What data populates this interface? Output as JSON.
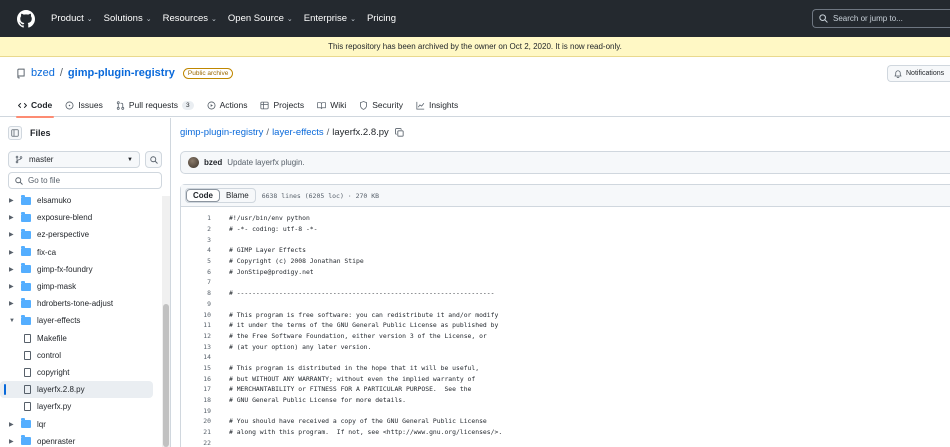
{
  "nav": {
    "items": [
      {
        "label": "Product",
        "dropdown": true
      },
      {
        "label": "Solutions",
        "dropdown": true
      },
      {
        "label": "Resources",
        "dropdown": true
      },
      {
        "label": "Open Source",
        "dropdown": true
      },
      {
        "label": "Enterprise",
        "dropdown": true
      },
      {
        "label": "Pricing",
        "dropdown": false
      }
    ],
    "search_placeholder": "Search or jump to..."
  },
  "banner": {
    "text": "This repository has been archived by the owner on Oct 2, 2020. It is now read-only."
  },
  "repo": {
    "owner": "bzed",
    "separator": "/",
    "name": "gimp-plugin-registry",
    "badge": "Public archive",
    "notifications_label": "Notifications"
  },
  "tabs": [
    {
      "label": "Code",
      "icon": "code-icon",
      "active": true
    },
    {
      "label": "Issues",
      "icon": "issue-icon"
    },
    {
      "label": "Pull requests",
      "icon": "pull-request-icon",
      "count": "3"
    },
    {
      "label": "Actions",
      "icon": "play-icon"
    },
    {
      "label": "Projects",
      "icon": "table-icon"
    },
    {
      "label": "Wiki",
      "icon": "book-icon"
    },
    {
      "label": "Security",
      "icon": "shield-icon"
    },
    {
      "label": "Insights",
      "icon": "graph-icon"
    }
  ],
  "sidebar": {
    "title": "Files",
    "branch": "master",
    "goto_placeholder": "Go to file",
    "tree": [
      {
        "label": "elsamuko",
        "type": "folder",
        "expanded": false
      },
      {
        "label": "exposure-blend",
        "type": "folder",
        "expanded": false
      },
      {
        "label": "ez-perspective",
        "type": "folder",
        "expanded": false
      },
      {
        "label": "fix-ca",
        "type": "folder",
        "expanded": false
      },
      {
        "label": "gimp-fx-foundry",
        "type": "folder",
        "expanded": false
      },
      {
        "label": "gimp-mask",
        "type": "folder",
        "expanded": false
      },
      {
        "label": "hdroberts-tone-adjust",
        "type": "folder",
        "expanded": false
      },
      {
        "label": "layer-effects",
        "type": "folder",
        "expanded": true
      },
      {
        "label": "Makefile",
        "type": "file"
      },
      {
        "label": "control",
        "type": "file"
      },
      {
        "label": "copyright",
        "type": "file"
      },
      {
        "label": "layerfx.2.8.py",
        "type": "file",
        "selected": true
      },
      {
        "label": "layerfx.py",
        "type": "file"
      },
      {
        "label": "lqr",
        "type": "folder",
        "expanded": false
      },
      {
        "label": "openraster",
        "type": "folder",
        "expanded": false
      }
    ]
  },
  "breadcrumb": {
    "repo": "gimp-plugin-registry",
    "folder": "layer-effects",
    "file": "layerfx.2.8.py",
    "sep": "/"
  },
  "commit": {
    "author": "bzed",
    "message": "Update layerfx plugin."
  },
  "code": {
    "code_tab": "Code",
    "blame_tab": "Blame",
    "meta": "6638 lines (6205 loc) · 270 KB",
    "lines": [
      {
        "n": "1",
        "t": "#!/usr/bin/env python"
      },
      {
        "n": "2",
        "t": "# -*- coding: utf-8 -*-"
      },
      {
        "n": "3",
        "t": ""
      },
      {
        "n": "4",
        "t": "# GIMP Layer Effects"
      },
      {
        "n": "5",
        "t": "# Copyright (c) 2008 Jonathan Stipe"
      },
      {
        "n": "6",
        "t": "# JonStipe@prodigy.net"
      },
      {
        "n": "7",
        "t": ""
      },
      {
        "n": "8",
        "t": "# -------------------------------------------------------------------"
      },
      {
        "n": "9",
        "t": ""
      },
      {
        "n": "10",
        "t": "# This program is free software: you can redistribute it and/or modify"
      },
      {
        "n": "11",
        "t": "# it under the terms of the GNU General Public License as published by"
      },
      {
        "n": "12",
        "t": "# the Free Software Foundation, either version 3 of the License, or"
      },
      {
        "n": "13",
        "t": "# (at your option) any later version."
      },
      {
        "n": "14",
        "t": ""
      },
      {
        "n": "15",
        "t": "# This program is distributed in the hope that it will be useful,"
      },
      {
        "n": "16",
        "t": "# but WITHOUT ANY WARRANTY; without even the implied warranty of"
      },
      {
        "n": "17",
        "t": "# MERCHANTABILITY or FITNESS FOR A PARTICULAR PURPOSE.  See the"
      },
      {
        "n": "18",
        "t": "# GNU General Public License for more details."
      },
      {
        "n": "19",
        "t": ""
      },
      {
        "n": "20",
        "t": "# You should have received a copy of the GNU General Public License"
      },
      {
        "n": "21",
        "t": "# along with this program.  If not, see <http://www.gnu.org/licenses/>."
      },
      {
        "n": "22",
        "t": ""
      }
    ]
  },
  "colors": {
    "nav_bg": "#24292f",
    "banner_bg": "#fff8c5",
    "link": "#0969da",
    "folder": "#54aeff",
    "active_tab": "#fd8c73"
  }
}
